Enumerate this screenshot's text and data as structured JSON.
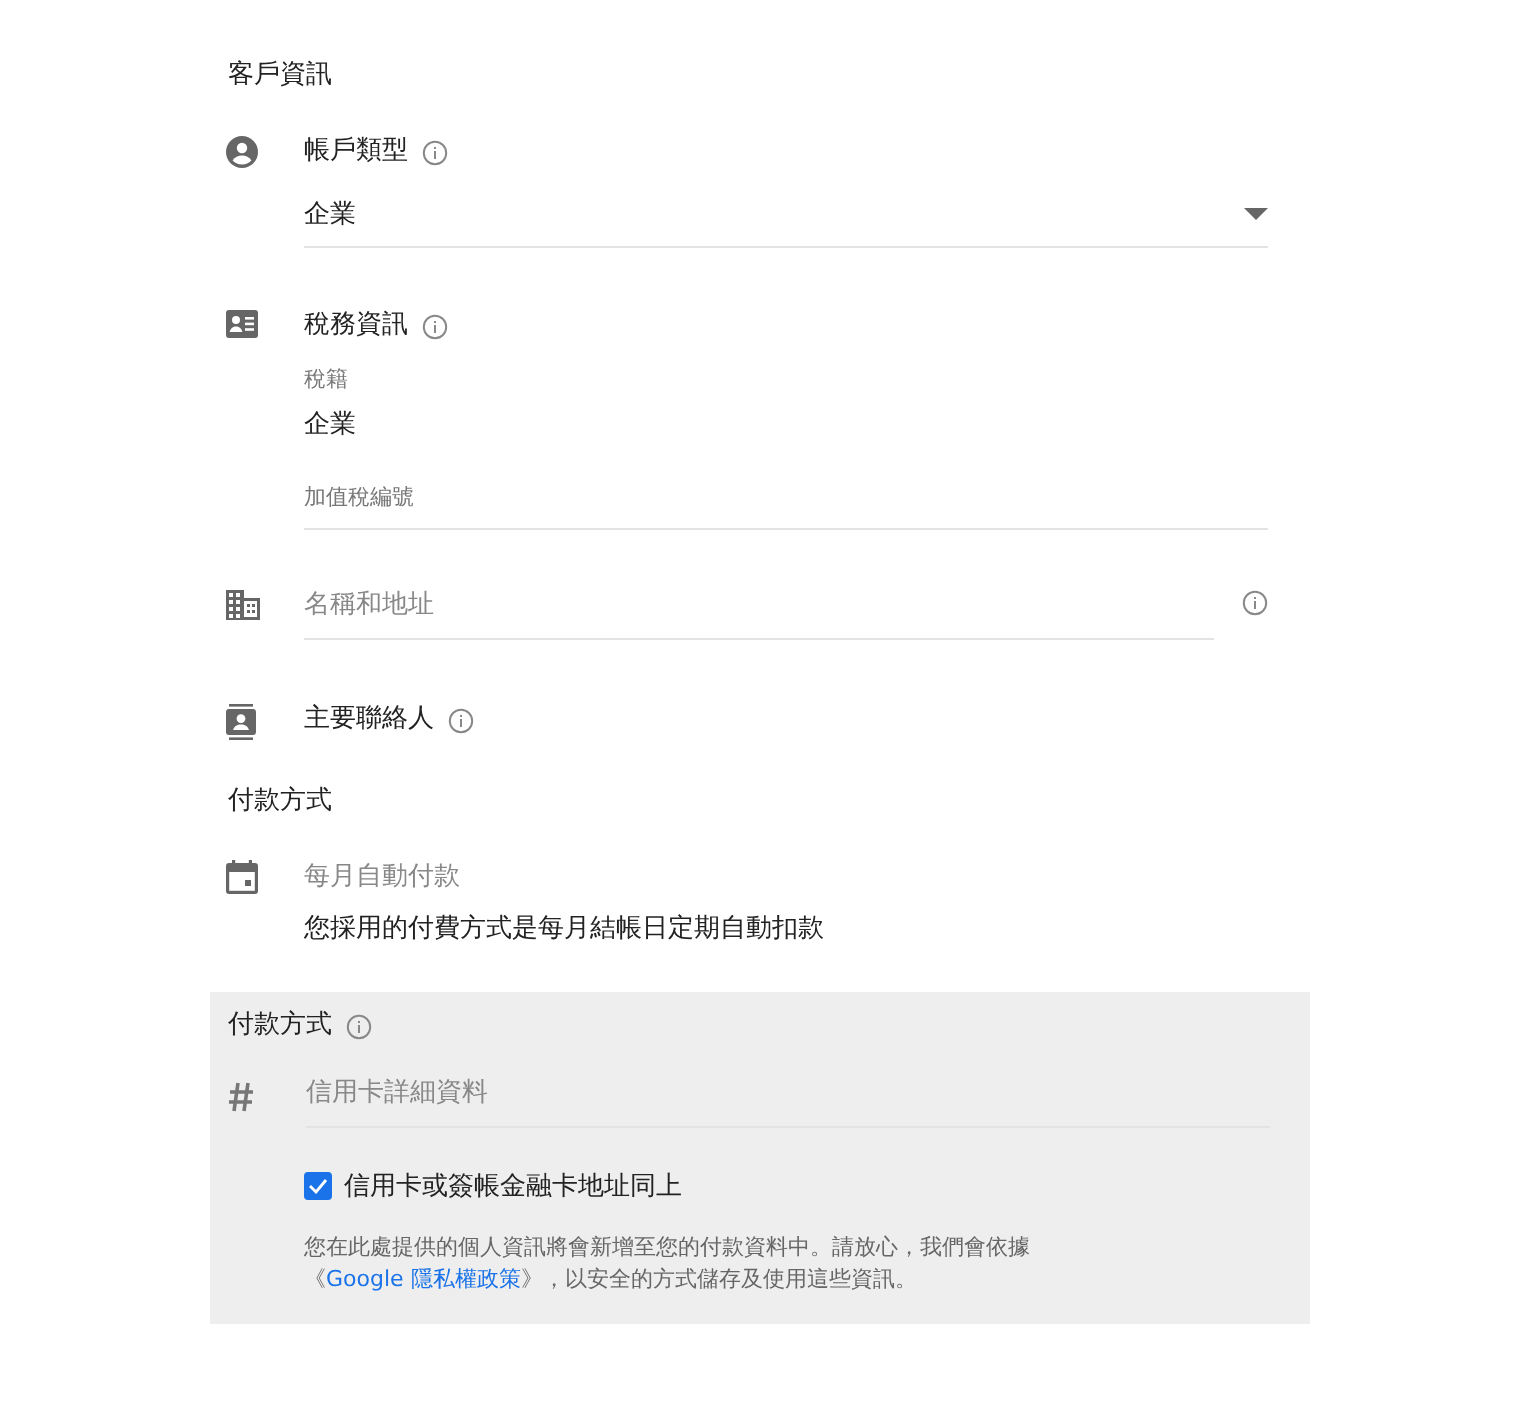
{
  "customer_info": {
    "title": "客戶資訊",
    "account_type": {
      "label": "帳戶類型",
      "value": "企業"
    },
    "tax_info": {
      "label": "稅務資訊",
      "tax_status_label": "稅籍",
      "tax_status_value": "企業",
      "vat_label": "加值稅編號"
    },
    "name_address": {
      "placeholder": "名稱和地址"
    },
    "primary_contact": {
      "label": "主要聯絡人"
    }
  },
  "payment_method": {
    "title": "付款方式",
    "auto_pay": {
      "label": "每月自動付款",
      "description": "您採用的付費方式是每月結帳日定期自動扣款"
    }
  },
  "payment_panel": {
    "title": "付款方式",
    "card_placeholder": "信用卡詳細資料",
    "same_address": {
      "label": "信用卡或簽帳金融卡地址同上",
      "checked": true
    },
    "notice": {
      "before": "您在此處提供的個人資訊將會新增至您的付款資料中。請放心，我們會依據《",
      "link": "Google 隱私權政策",
      "after": "》，以安全的方式儲存及使用這些資訊。"
    }
  }
}
